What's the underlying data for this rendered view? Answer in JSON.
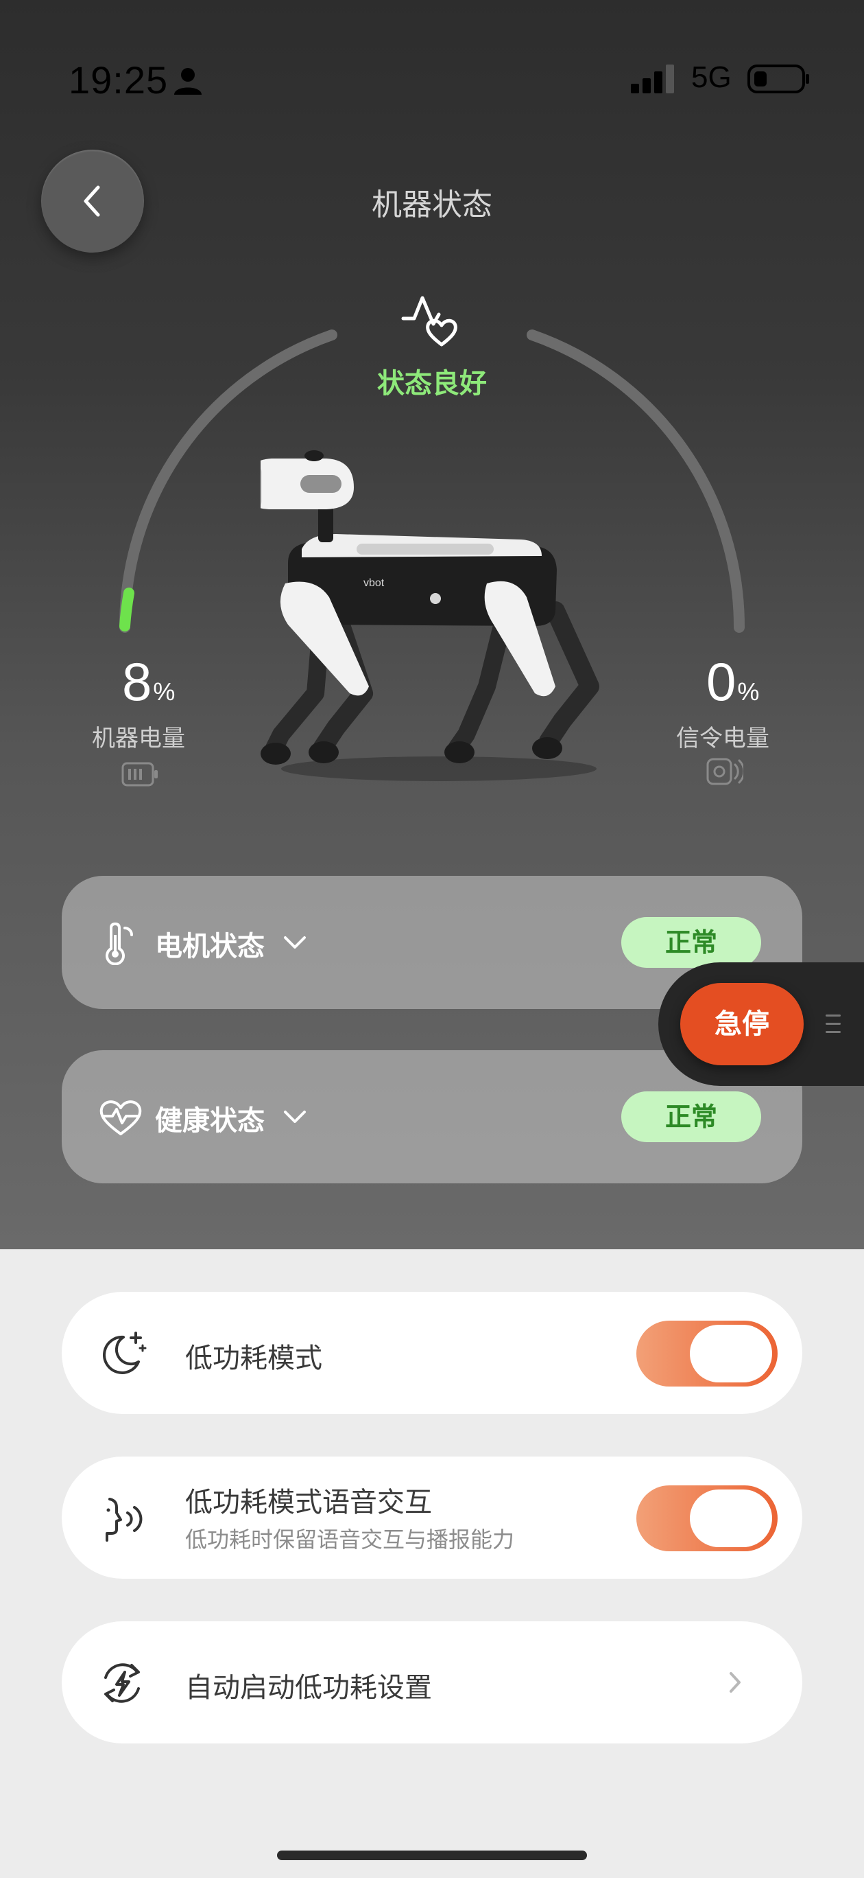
{
  "status_bar": {
    "time": "19:25",
    "network": "5G"
  },
  "header": {
    "title": "机器状态"
  },
  "gauge": {
    "status_text": "状态良好",
    "status_color": "#8ee97a",
    "robot_battery": {
      "value": "8",
      "unit": "%",
      "label": "机器电量",
      "level": 0.08
    },
    "signal_battery": {
      "value": "0",
      "unit": "%",
      "label": "信令电量",
      "level": 0.0
    }
  },
  "robot": {
    "brand_text": "vbot"
  },
  "cards": [
    {
      "label": "电机状态",
      "status": "正常",
      "icon": "thermometer-icon"
    },
    {
      "label": "健康状态",
      "status": "正常",
      "icon": "heartbeat-icon"
    }
  ],
  "emergency_stop": {
    "label": "急停",
    "color": "#e44e22"
  },
  "settings": [
    {
      "title": "低功耗模式",
      "icon": "moon-stars-icon",
      "toggle": true
    },
    {
      "title": "低功耗模式语音交互",
      "subtitle": "低功耗时保留语音交互与播报能力",
      "icon": "voice-icon",
      "toggle": true
    },
    {
      "title": "自动启动低功耗设置",
      "icon": "auto-power-icon",
      "arrow": true
    }
  ],
  "colors": {
    "accent": "#ec6434",
    "ok_bg": "#c6f5c0",
    "ok_text": "#2d8a26"
  }
}
